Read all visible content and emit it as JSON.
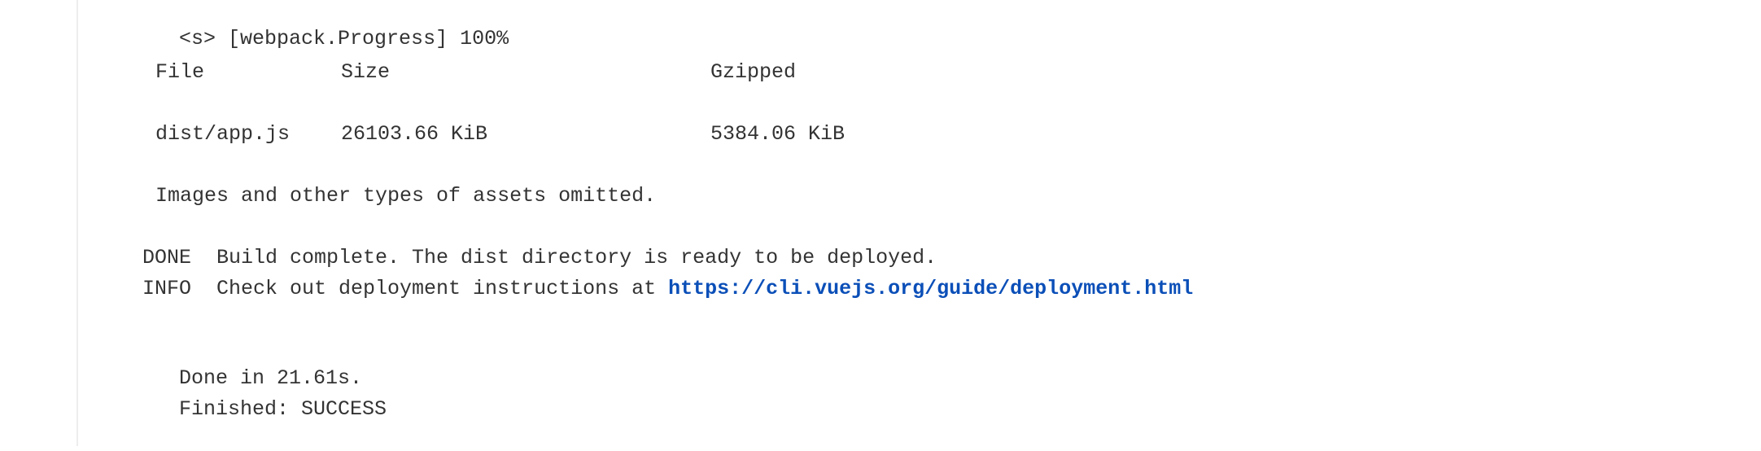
{
  "console": {
    "progress_line": "<s> [webpack.Progress] 100%",
    "table": {
      "headers": [
        "File",
        "Size",
        "Gzipped"
      ],
      "rows": [
        {
          "file": "dist/app.js",
          "size": "26103.66 KiB",
          "gzipped": "5384.06 KiB"
        }
      ]
    },
    "assets_note": "Images and other types of assets omitted.",
    "done_tag": "DONE",
    "done_message": "Build complete. The dist directory is ready to be deployed.",
    "info_tag": "INFO",
    "info_message": "Check out deployment instructions at",
    "info_link": "https://cli.vuejs.org/guide/deployment.html",
    "done_time": "Done in 21.61s.",
    "finished": "Finished: SUCCESS"
  },
  "colors": {
    "text": "#333333",
    "link": "#0b4fb8",
    "gutter_border": "#ededed"
  }
}
